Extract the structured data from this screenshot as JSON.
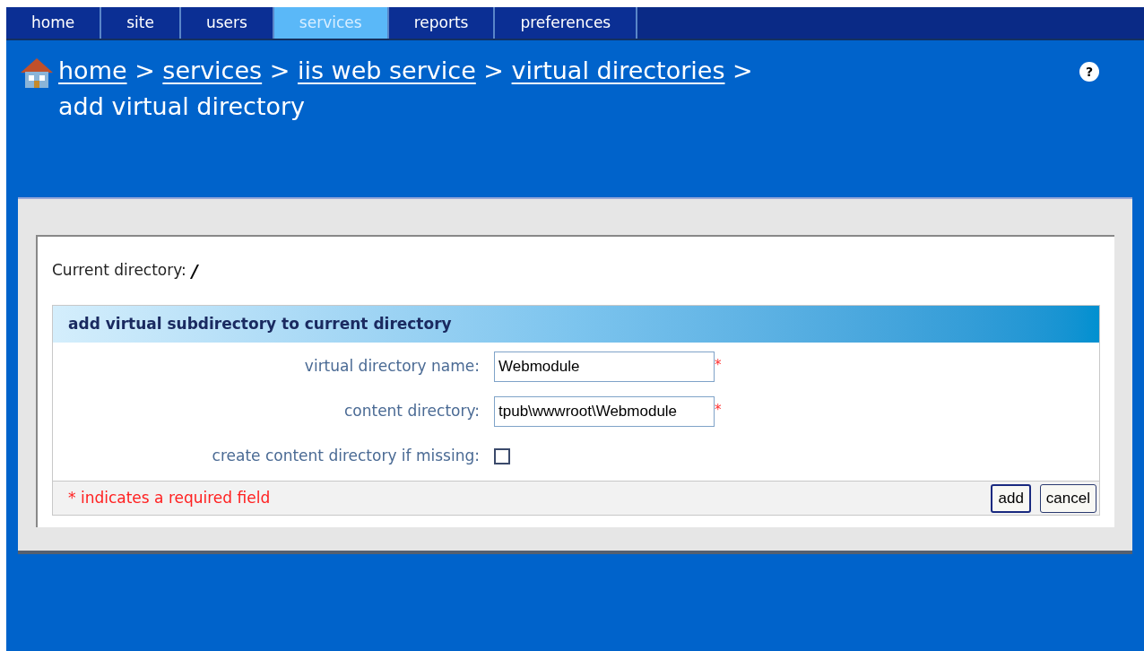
{
  "tabs": [
    {
      "label": "home",
      "selected": false
    },
    {
      "label": "site",
      "selected": false
    },
    {
      "label": "users",
      "selected": false
    },
    {
      "label": "services",
      "selected": true
    },
    {
      "label": "reports",
      "selected": false
    },
    {
      "label": "preferences",
      "selected": false
    }
  ],
  "breadcrumb": {
    "links": [
      "home",
      "services",
      "iis web service",
      "virtual directories"
    ],
    "separator": ">",
    "current": "add virtual directory"
  },
  "help": {
    "label": "?"
  },
  "current_directory": {
    "label": "Current directory:",
    "value": "/"
  },
  "form": {
    "title": "add virtual subdirectory to current directory",
    "fields": [
      {
        "kind": "text",
        "label": "virtual directory name:",
        "value": "Webmodule",
        "required_mark": "*"
      },
      {
        "kind": "text",
        "label": "content directory:",
        "value": "tpub\\wwwroot\\Webmodule",
        "required_mark": "*"
      },
      {
        "kind": "checkbox",
        "label": "create content directory if missing:",
        "checked": false
      }
    ],
    "footnote": "* indicates a required field",
    "buttons": [
      {
        "label": "add",
        "selected": true
      },
      {
        "label": "cancel",
        "selected": false
      }
    ]
  }
}
